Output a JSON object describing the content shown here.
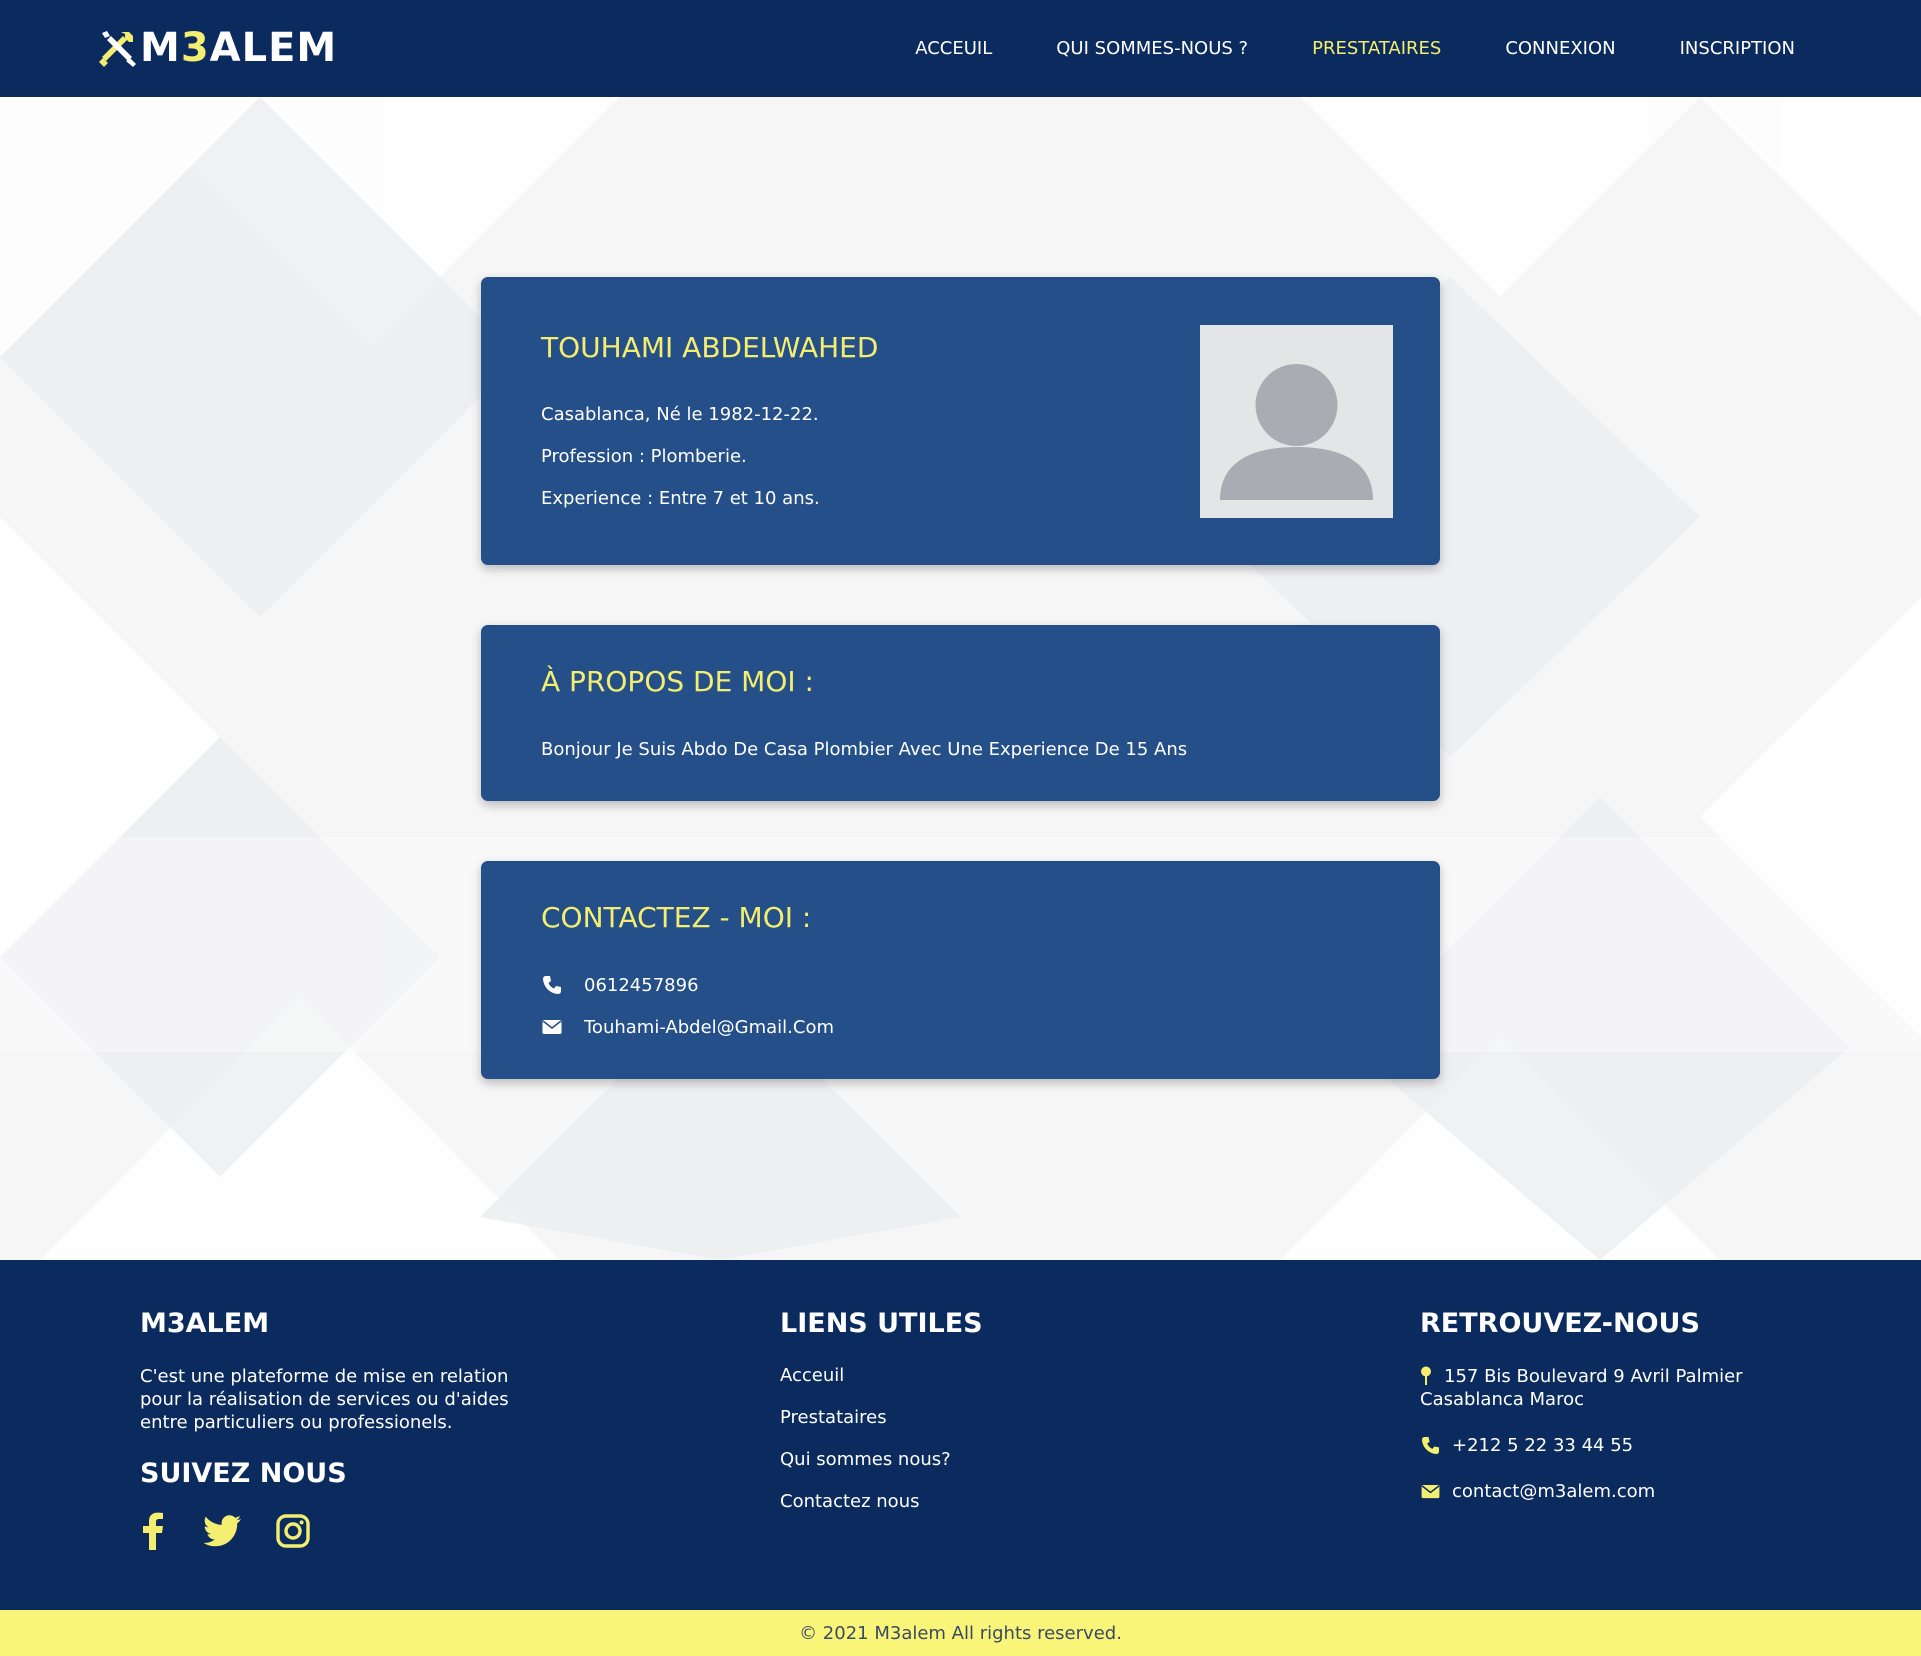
{
  "brand": {
    "logo_prefix": "M",
    "logo_accent": "3",
    "logo_suffix": "ALEM"
  },
  "nav": {
    "items": [
      {
        "label": "ACCEUIL",
        "active": false
      },
      {
        "label": "QUI SOMMES-NOUS ?",
        "active": false
      },
      {
        "label": "PRESTATAIRES",
        "active": true
      },
      {
        "label": "CONNEXION",
        "active": false
      },
      {
        "label": "INSCRIPTION",
        "active": false
      }
    ]
  },
  "profile": {
    "name": "TOUHAMI ABDELWAHED",
    "birth_line": "Casablanca, Né le 1982-12-22.",
    "profession_line": "Profession : Plomberie.",
    "experience_line": "Experience : Entre 7 et 10 ans."
  },
  "about": {
    "title": "À PROPOS DE MOI :",
    "text": "Bonjour Je Suis Abdo De Casa Plombier Avec Une Experience De 15 Ans"
  },
  "contact": {
    "title": "CONTACTEZ - MOI :",
    "phone": "0612457896",
    "email": "Touhami-Abdel@Gmail.Com",
    "phone_icon": "phone-icon",
    "email_icon": "envelope-icon"
  },
  "footer": {
    "about_title": "M3ALEM",
    "about_lines": [
      "C'est une plateforme de mise en relation",
      "pour la réalisation de services ou d'aides",
      "entre particuliers ou professionels."
    ],
    "follow_title": "SUIVEZ NOUS",
    "social_icons": [
      "facebook-icon",
      "twitter-icon",
      "instagram-icon"
    ],
    "links_title": "LIENS UTILES",
    "links": [
      "Acceuil",
      "Prestataires",
      "Qui sommes nous?",
      "Contactez nous"
    ],
    "find_title": "RETROUVEZ-NOUS",
    "address_lines": [
      "157 Bis Boulevard 9 Avril Palmier",
      "Casablanca Maroc"
    ],
    "phone": "+212 5 22 33 44 55",
    "email": "contact@m3alem.com"
  },
  "copyright": "© 2021 M3alem All rights reserved.",
  "colors": {
    "navy": "#0b2b5e",
    "card_blue": "#244f88",
    "accent_yellow": "#f4ee70",
    "copyright_bg": "#f8f578"
  }
}
